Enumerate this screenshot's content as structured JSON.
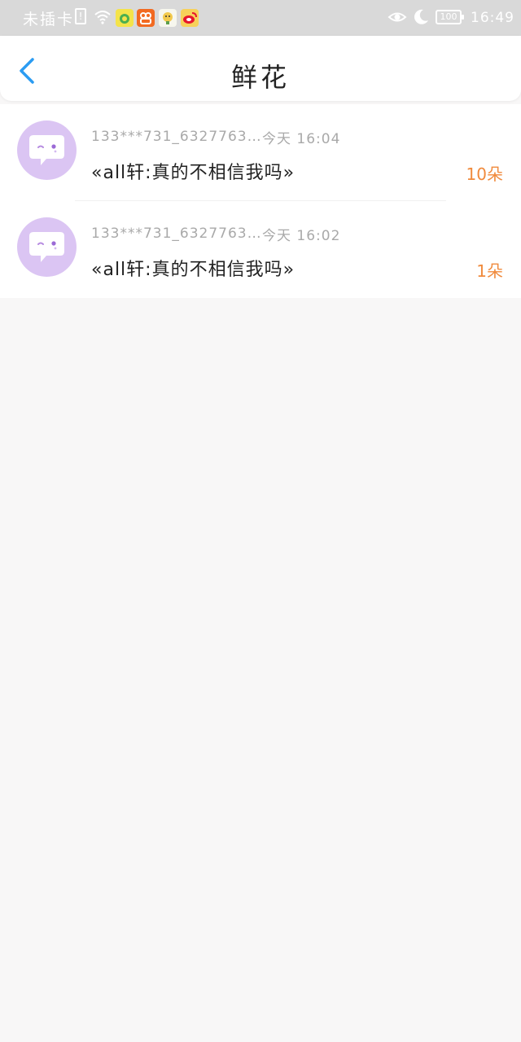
{
  "status_bar": {
    "carrier": "未插卡",
    "sim_icon_text": "!",
    "battery": "100",
    "time": "16:49",
    "icons": [
      "sim-alert-icon",
      "wifi-icon",
      "app-notification-icon",
      "app-notification-icon",
      "app-notification-icon",
      "weibo-icon",
      "eye-comfort-icon",
      "moon-icon",
      "battery-icon"
    ]
  },
  "header": {
    "title": "鲜花",
    "back_icon": "chevron-left-icon"
  },
  "colors": {
    "accent": "#2b9cf2",
    "count": "#f08a3c",
    "avatar_bg": "#dbc5f3",
    "background": "#f8f7f7"
  },
  "items": [
    {
      "sender": "133***731_6327763…",
      "time": "今天 16:04",
      "message": "«all轩:真的不相信我吗»",
      "count": "10朵",
      "avatar_icon": "chat-bubble-icon"
    },
    {
      "sender": "133***731_6327763…",
      "time": "今天 16:02",
      "message": "«all轩:真的不相信我吗»",
      "count": "1朵",
      "avatar_icon": "chat-bubble-icon"
    }
  ]
}
